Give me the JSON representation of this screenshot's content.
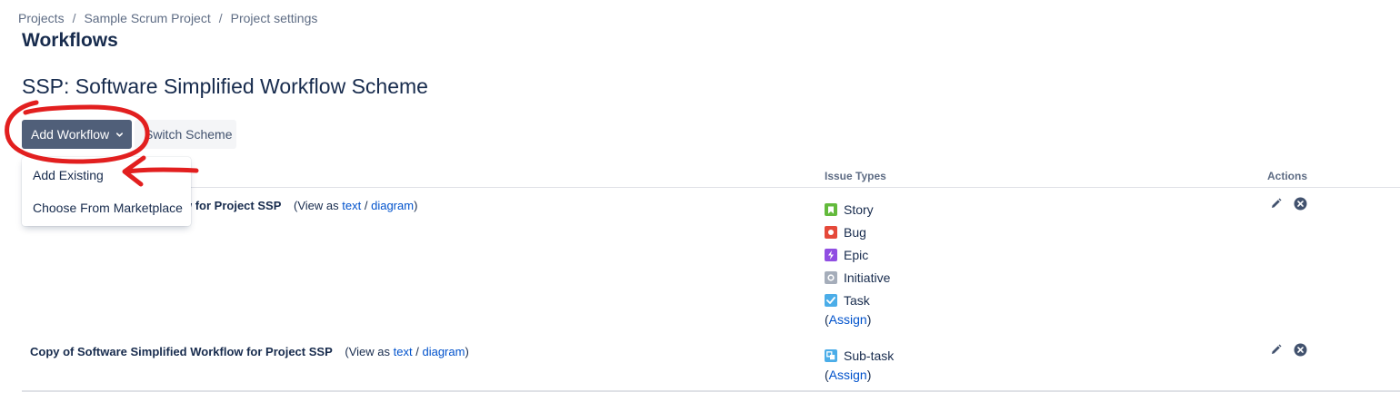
{
  "breadcrumb": {
    "items": [
      "Projects",
      "Sample Scrum Project",
      "Project settings"
    ],
    "separator": "/"
  },
  "page": {
    "title": "Workflows",
    "scheme_title": "SSP: Software Simplified Workflow Scheme"
  },
  "toolbar": {
    "add_workflow_label": "Add Workflow",
    "switch_scheme_label": "Switch Scheme"
  },
  "dropdown": {
    "items": [
      "Add Existing",
      "Choose From Marketplace"
    ]
  },
  "table": {
    "headers": {
      "issue_types": "Issue Types",
      "actions": "Actions"
    },
    "rows": [
      {
        "name_visible": "w for Project SSP",
        "view_prefix": "(View as",
        "text_link": "text",
        "slash": "/",
        "diagram_link": "diagram",
        "view_suffix": ")",
        "issue_types": [
          {
            "label": "Story",
            "icon": "story-icon",
            "color": "#63ba3c"
          },
          {
            "label": "Bug",
            "icon": "bug-icon",
            "color": "#e5493a"
          },
          {
            "label": "Epic",
            "icon": "epic-icon",
            "color": "#904ee2"
          },
          {
            "label": "Initiative",
            "icon": "initiative-icon",
            "color": "#a5adba"
          },
          {
            "label": "Task",
            "icon": "task-icon",
            "color": "#4bade8"
          }
        ],
        "assign_open": "(",
        "assign_link": "Assign",
        "assign_close": ")"
      },
      {
        "name_visible": "Copy of Software Simplified Workflow for Project SSP",
        "view_prefix": "(View as",
        "text_link": "text",
        "slash": "/",
        "diagram_link": "diagram",
        "view_suffix": ")",
        "issue_types": [
          {
            "label": "Sub-task",
            "icon": "subtask-icon",
            "color": "#4bade8"
          }
        ],
        "assign_open": "(",
        "assign_link": "Assign",
        "assign_close": ")"
      }
    ]
  },
  "colors": {
    "primary_button": "#505f79",
    "link": "#0052cc",
    "annotation": "#e21f1f"
  }
}
